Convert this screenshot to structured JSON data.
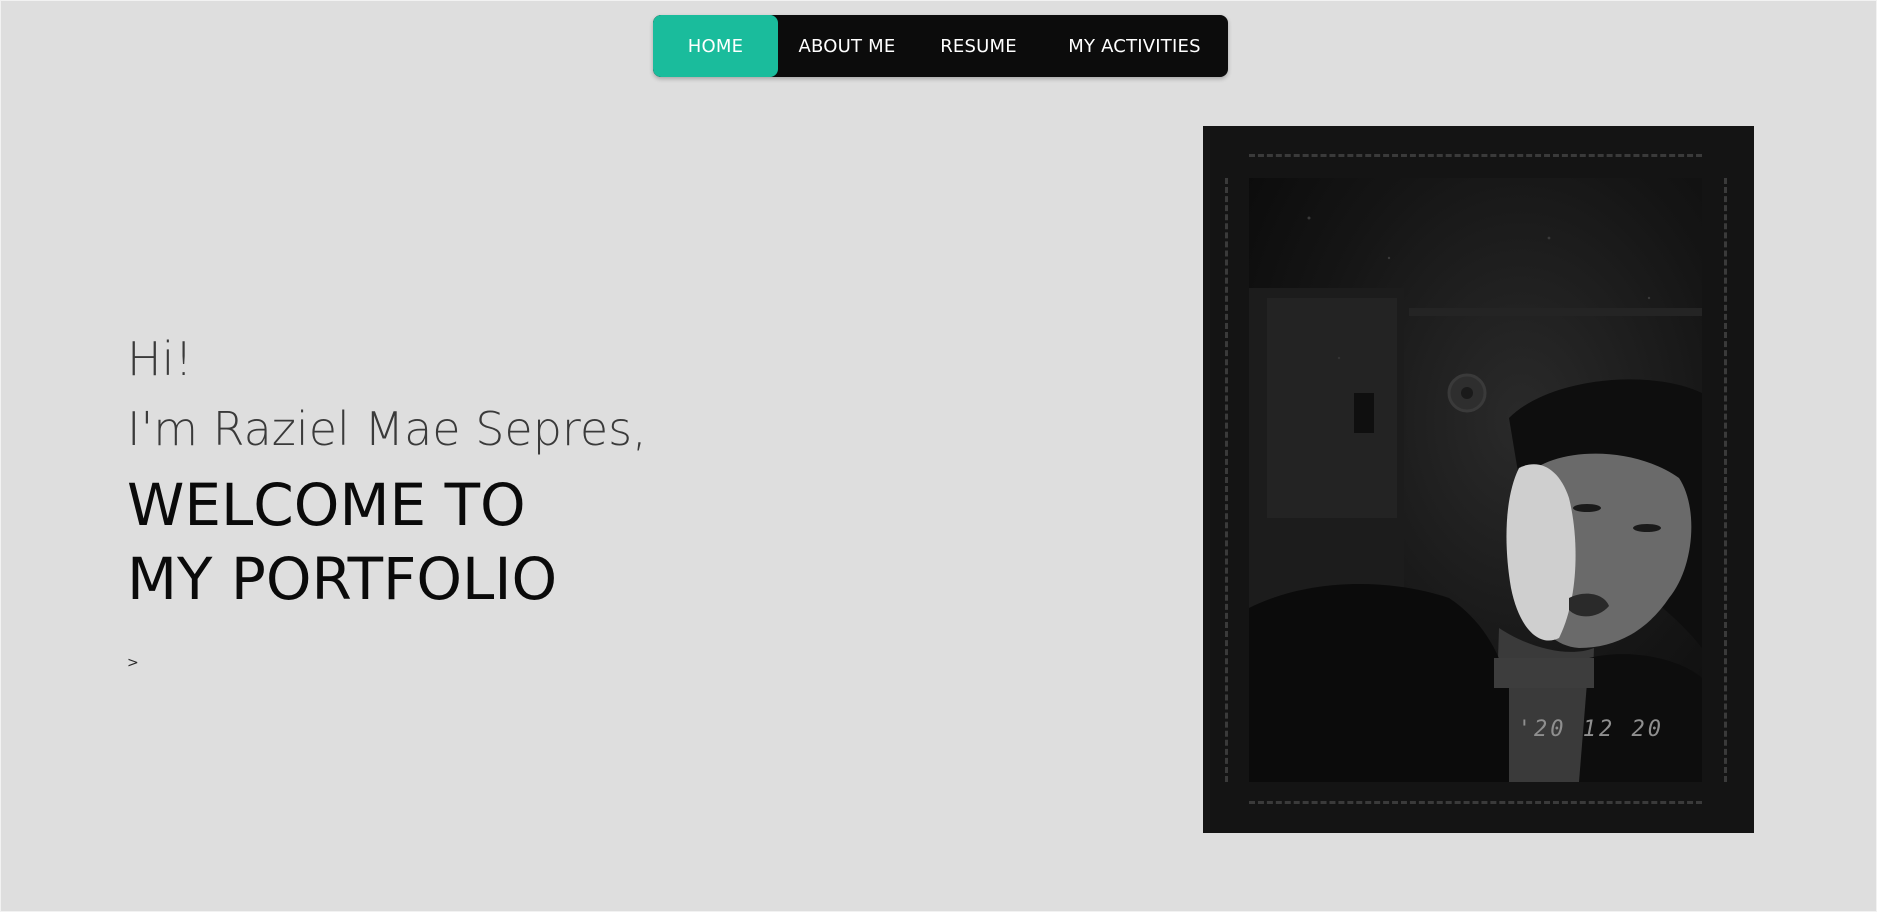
{
  "nav": {
    "items": [
      {
        "label": "HOME",
        "active": true
      },
      {
        "label": "ABOUT ME",
        "active": false
      },
      {
        "label": "RESUME",
        "active": false
      },
      {
        "label": "MY ACTIVITIES",
        "active": false
      }
    ],
    "active_color": "#1abc9c",
    "background_color": "#0c0c0c"
  },
  "hero": {
    "greeting": "Hi!",
    "intro": "I'm Raziel Mae Sepres,",
    "welcome_line1": "WELCOME TO",
    "welcome_line2": "MY PORTFOLIO",
    "arrow": ">"
  },
  "photo": {
    "date_stamp": "'20 12 20",
    "style": "black-and-white portrait in dashed film frame"
  }
}
